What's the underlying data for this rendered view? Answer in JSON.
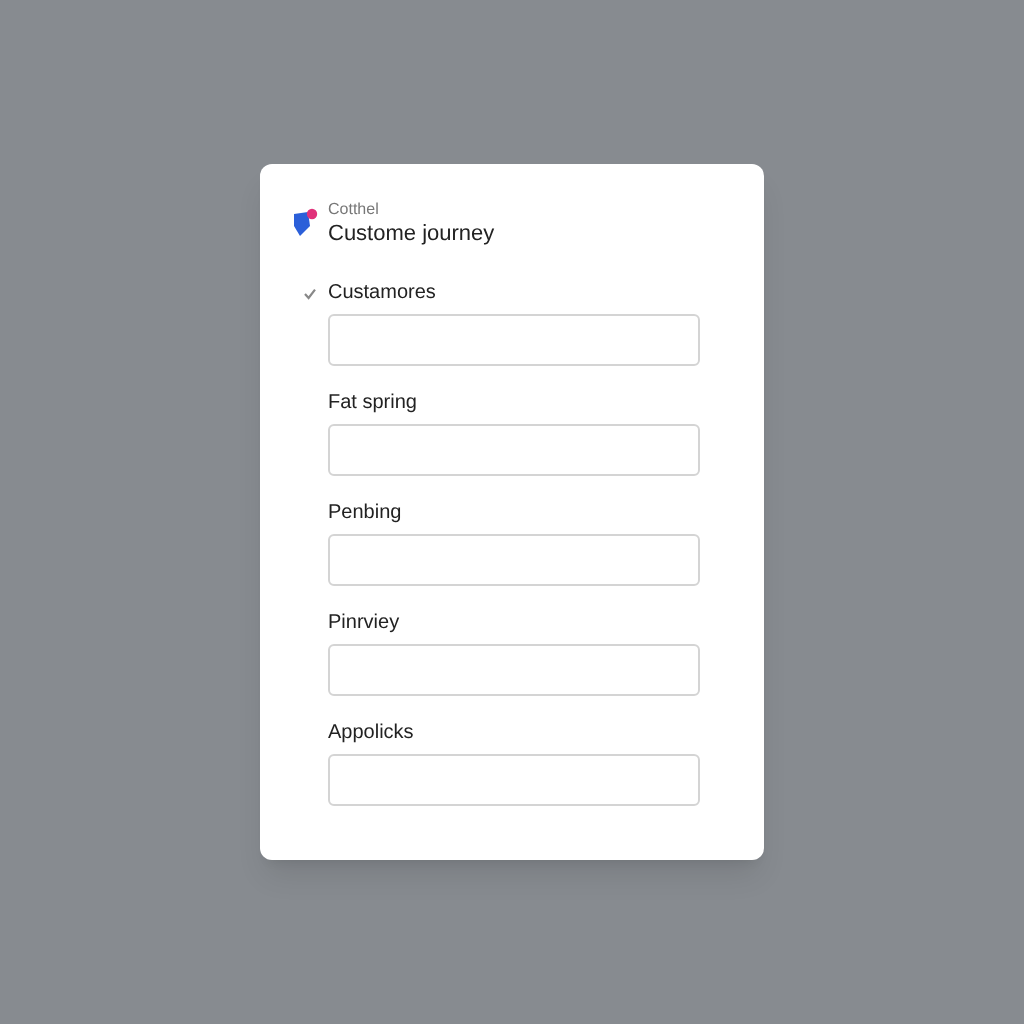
{
  "header": {
    "subtitle": "Cotthel",
    "title": "Custome journey"
  },
  "fields": [
    {
      "label": "Custamores",
      "marked": true
    },
    {
      "label": "Fat spring",
      "marked": false
    },
    {
      "label": "Penbing",
      "marked": false
    },
    {
      "label": "Pinrviey",
      "marked": false
    },
    {
      "label": "Appolicks",
      "marked": false
    }
  ]
}
